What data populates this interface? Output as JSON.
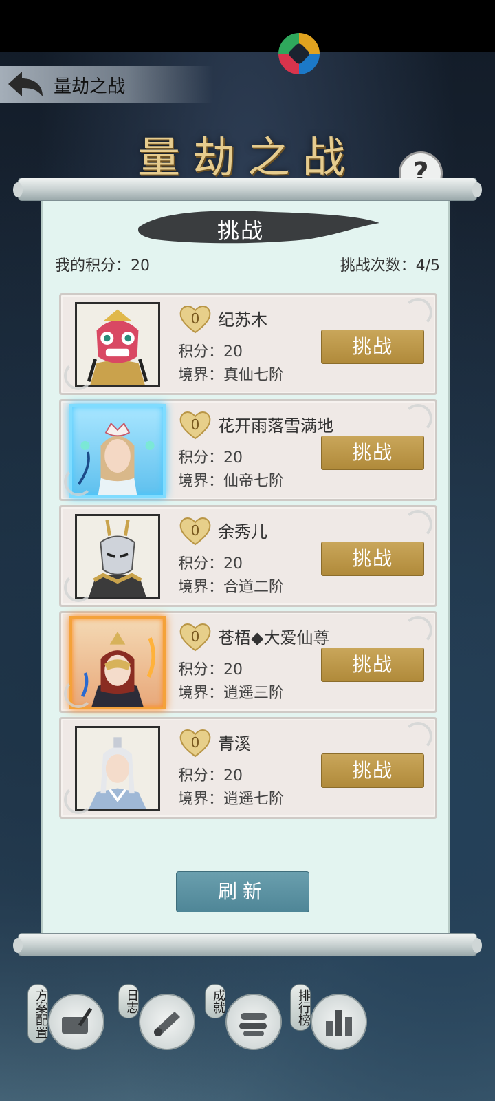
{
  "header": {
    "back_title": "量劫之战",
    "banner_title": "量劫之战",
    "help_symbol": "?"
  },
  "panel": {
    "title": "挑战",
    "my_score_label": "我的积分：",
    "my_score": "20",
    "challenge_count_label": "挑战次数：",
    "challenge_count": "4/5"
  },
  "opponents": [
    {
      "name": "纪苏木",
      "hearts": "0",
      "score": "积分：20",
      "realm": "境界：真仙七阶",
      "button": "挑战"
    },
    {
      "name": "花开雨落雪满地",
      "hearts": "0",
      "score": "积分：20",
      "realm": "境界：仙帝七阶",
      "button": "挑战"
    },
    {
      "name": "余秀儿",
      "hearts": "0",
      "score": "积分：20",
      "realm": "境界：合道二阶",
      "button": "挑战"
    },
    {
      "name": "苍梧◆大爱仙尊",
      "hearts": "0",
      "score": "积分：20",
      "realm": "境界：逍遥三阶",
      "button": "挑战"
    },
    {
      "name": "青溪",
      "hearts": "0",
      "score": "积分：20",
      "realm": "境界：逍遥七阶",
      "button": "挑战"
    }
  ],
  "refresh_label": "刷新",
  "bottom_nav": [
    {
      "label": "方案配置",
      "icon": "scroll-brush-icon"
    },
    {
      "label": "日志",
      "icon": "rolled-scroll-icon"
    },
    {
      "label": "成就",
      "icon": "scroll-bundle-icon"
    },
    {
      "label": "排行榜",
      "icon": "bar-ranking-icon"
    }
  ],
  "colors": {
    "accent_gold": "#b8913f",
    "refresh_teal": "#5a8e9f",
    "paper": "#e3f4f0",
    "card": "#efe9e6"
  }
}
